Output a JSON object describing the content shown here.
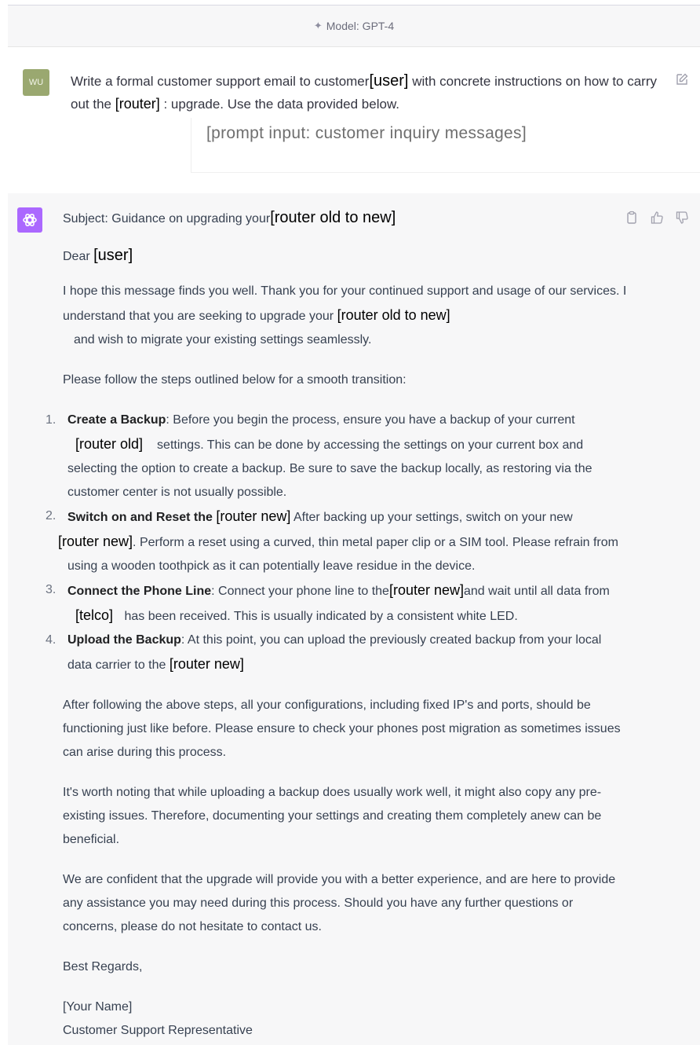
{
  "topbar": {
    "model_label": "Model: GPT-4",
    "icon": "sparkle-icon"
  },
  "user_message": {
    "avatar_initials": "WU",
    "part1": "Write a formal customer support email to customer",
    "ph_user": "[user]",
    "part2": " with concrete instructions on how to carry out the ",
    "ph_router": "[router]",
    "part3": " : upgrade. Use the data provided below.",
    "prompt_input": "[prompt input: customer inquiry messages]",
    "edit_icon": "edit-icon"
  },
  "assistant": {
    "actions": [
      "copy-icon",
      "thumbs-up-icon",
      "thumbs-down-icon"
    ],
    "subject_prefix": "Subject: Guidance on upgrading your",
    "ph_router_old_new": "[router old to new]",
    "dear_prefix": "Dear ",
    "ph_user": "[user]",
    "intro_a": "I hope this message finds you well. Thank you for your continued support and usage of our services. I understand that you are seeking to upgrade your ",
    "intro_b": "and wish to migrate your existing settings seamlessly.",
    "steps_intro": "Please follow the steps outlined below for a smooth transition:",
    "steps": [
      {
        "num": "1.",
        "title": "Create a Backup",
        "a": ": Before you begin the process, ensure you have a backup of your current",
        "ph": "[router old]",
        "b": "settings. This can be done by accessing the settings on your current box and selecting the option to create a backup. Be sure to save the backup locally, as restoring via the customer center is not usually possible."
      },
      {
        "num": "2.",
        "title": "Switch on and Reset the ",
        "ph": "[router new]",
        "a": " After backing up your settings, switch on your new",
        "ph2": "[router new]",
        "b": ". Perform a reset using a curved, thin metal paper clip or a SIM tool. Please refrain from using a wooden toothpick as it can potentially leave residue in the device."
      },
      {
        "num": "3.",
        "title": "Connect the Phone Line",
        "a": ": Connect your phone line to the",
        "ph": "[router new]",
        "b": "and wait until all data from ",
        "ph2": "[telco]",
        "c": " has been received. This is usually indicated by a consistent white LED."
      },
      {
        "num": "4.",
        "title": "Upload the Backup",
        "a": ": At this point, you can upload the previously created backup from your local data carrier to the ",
        "ph": "[router new]"
      }
    ],
    "para_after": "After following the above steps, all your configurations, including fixed IP's and ports, should be functioning just like before. Please ensure to check your phones post migration as sometimes issues can arise during this process.",
    "para_note": "It's worth noting that while uploading a backup does usually work well, it might also copy any pre-existing issues. Therefore, documenting your settings and creating them completely anew can be beneficial.",
    "para_confident": "We are confident that the upgrade will provide you with a better experience, and are here to provide any assistance you may need during this process. Should you have any further questions or concerns, please do not hesitate to contact us.",
    "closing": "Best Regards,",
    "sig_name": "[Your Name]",
    "sig_title": "Customer Support Representative"
  }
}
